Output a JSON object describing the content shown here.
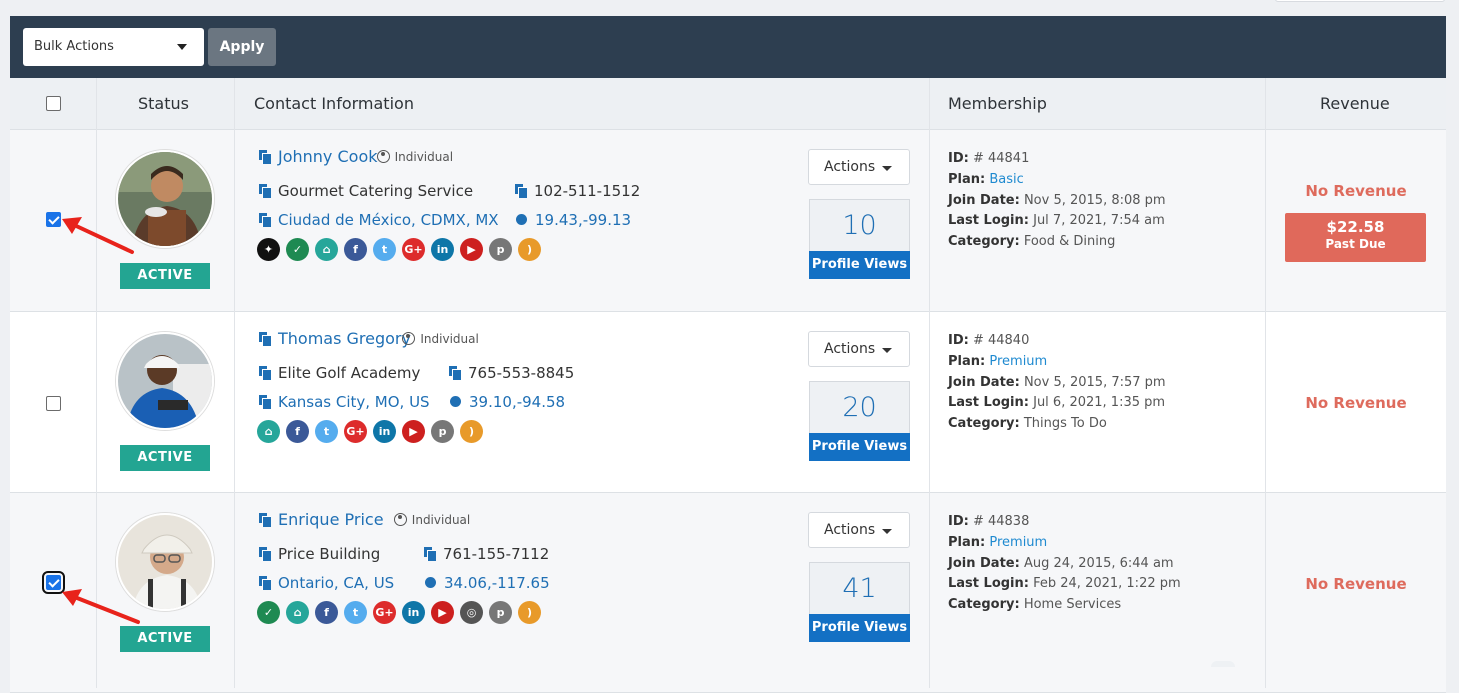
{
  "toolbar": {
    "bulk_actions": "Bulk Actions",
    "apply": "Apply"
  },
  "table": {
    "headers": {
      "status": "Status",
      "contact": "Contact Information",
      "membership": "Membership",
      "revenue": "Revenue"
    },
    "labels": {
      "actions": "Actions",
      "profile_views": "Profile Views",
      "id": "ID:",
      "plan": "Plan:",
      "join_date": "Join Date:",
      "last_login": "Last Login:",
      "category": "Category:",
      "no_revenue": "No Revenue"
    },
    "rows": [
      {
        "checked": true,
        "status": "ACTIVE",
        "name": "Johnny Cook",
        "type": "Individual",
        "company": "Gourmet Catering Service",
        "phone": "102-511-1512",
        "location": "Ciudad de México, CDMX, MX",
        "coords": "19.43,-99.13",
        "socials": [
          "pin-icon",
          "verified-icon",
          "home-icon",
          "facebook-icon",
          "twitter-icon",
          "google-plus-icon",
          "linkedin-icon",
          "youtube-icon",
          "pinterest-icon",
          "rss-icon"
        ],
        "views": "10",
        "id": "# 44841",
        "plan": "Basic",
        "join_date": "Nov 5, 2015, 8:08 pm",
        "last_login": "Jul 7, 2021, 7:54 am",
        "category": "Food & Dining",
        "revenue": "No Revenue",
        "past_due_amount": "$22.58",
        "past_due_label": "Past Due"
      },
      {
        "checked": false,
        "status": "ACTIVE",
        "name": "Thomas Gregory",
        "type": "Individual",
        "company": "Elite Golf Academy",
        "phone": "765-553-8845",
        "location": "Kansas City, MO, US",
        "coords": "39.10,-94.58",
        "socials": [
          "home-icon",
          "facebook-icon",
          "twitter-icon",
          "google-plus-icon",
          "linkedin-icon",
          "youtube-icon",
          "pinterest-icon",
          "rss-icon"
        ],
        "views": "20",
        "id": "# 44840",
        "plan": "Premium",
        "join_date": "Nov 5, 2015, 7:57 pm",
        "last_login": "Jul 6, 2021, 1:35 pm",
        "category": "Things To Do",
        "revenue": "No Revenue"
      },
      {
        "checked": true,
        "status": "ACTIVE",
        "name": "Enrique Price",
        "type": "Individual",
        "company": "Price Building",
        "phone": "761-155-7112",
        "location": "Ontario, CA, US",
        "coords": "34.06,-117.65",
        "socials": [
          "verified-icon",
          "home-icon",
          "facebook-icon",
          "twitter-icon",
          "google-plus-icon",
          "linkedin-icon",
          "youtube-icon",
          "instagram-icon",
          "pinterest-icon",
          "rss-icon"
        ],
        "views": "41",
        "id": "# 44838",
        "plan": "Premium",
        "join_date": "Aug 24, 2015, 6:44 am",
        "last_login": "Feb 24, 2021, 1:22 pm",
        "category": "Home Services",
        "revenue": "No Revenue"
      }
    ]
  },
  "social_icons": {
    "pin-icon": {
      "color": "#111111",
      "glyph": "✦"
    },
    "verified-icon": {
      "color": "#1e8a52",
      "glyph": "✓"
    },
    "home-icon": {
      "color": "#26a69a",
      "glyph": "⌂"
    },
    "facebook-icon": {
      "color": "#3b5998",
      "glyph": "f"
    },
    "twitter-icon": {
      "color": "#55acee",
      "glyph": "t"
    },
    "google-plus-icon": {
      "color": "#dd2c2c",
      "glyph": "G+"
    },
    "linkedin-icon": {
      "color": "#0e76a8",
      "glyph": "in"
    },
    "youtube-icon": {
      "color": "#cd201f",
      "glyph": "▶"
    },
    "instagram-icon": {
      "color": "#555555",
      "glyph": "◎"
    },
    "pinterest-icon": {
      "color": "#777777",
      "glyph": "p"
    },
    "rss-icon": {
      "color": "#e89a2a",
      "glyph": ")"
    }
  }
}
